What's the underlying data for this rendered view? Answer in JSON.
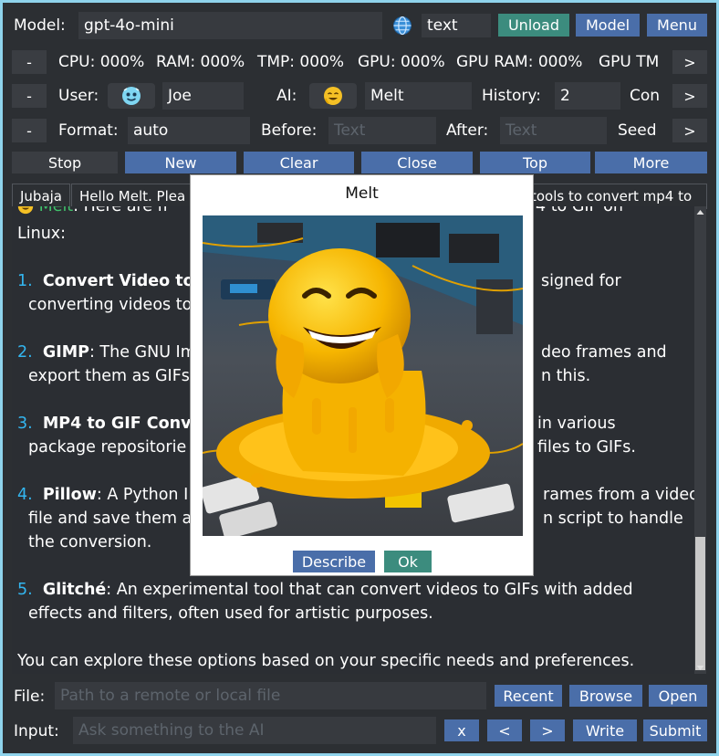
{
  "toolbar": {
    "model_label": "Model:",
    "model_value": "gpt-4o-mini",
    "mode_value": "text",
    "unload_label": "Unload",
    "model_button_label": "Model",
    "menu_label": "Menu"
  },
  "stats": {
    "collapse_label": "-",
    "cpu": "CPU: 000%",
    "ram": "RAM: 000%",
    "tmp": "TMP: 000%",
    "gpu": "GPU: 000%",
    "gpu_ram": "GPU RAM: 000%",
    "gpu_tmp": "GPU TM",
    "next_label": ">"
  },
  "users": {
    "collapse_label": "-",
    "user_label": "User:",
    "user_name": "Joe",
    "ai_label": "AI:",
    "ai_name": "Melt",
    "history_label": "History:",
    "history_value": "2",
    "con_label": "Con",
    "next_label": ">"
  },
  "format": {
    "collapse_label": "-",
    "format_label": "Format:",
    "format_value": "auto",
    "before_label": "Before:",
    "before_placeholder": "Text",
    "after_label": "After:",
    "after_placeholder": "Text",
    "seed_label": "Seed",
    "next_label": ">"
  },
  "actions": {
    "stop": "Stop",
    "new": "New",
    "clear": "Clear",
    "close": "Close",
    "top": "Top",
    "more": "More"
  },
  "tabs": [
    {
      "label": "Jubaja"
    },
    {
      "label": "Hello Melt. Plea"
    },
    {
      "label": "tools to convert mp4 to"
    }
  ],
  "chat": {
    "header_name": "Melt",
    "header_rest": ": Here are fr",
    "header_right": "4 to GIF on",
    "line_linux": "Linux:",
    "items": [
      {
        "num": "1.",
        "title": "Convert Video to",
        "rest": "",
        "right": "signed for",
        "line2": "converting videos to",
        "line2_right": ""
      },
      {
        "num": "2.",
        "title": "GIMP",
        "rest": ": The GNU Im",
        "right": "deo frames and",
        "line2": "export them as GIFs",
        "line2_right": "n this."
      },
      {
        "num": "3.",
        "title": "MP4 to GIF Conve",
        "rest": "",
        "right": "in various",
        "line2": "package repositorie",
        "line2_right": "files to GIFs."
      },
      {
        "num": "4.",
        "title": "Pillow",
        "rest": ": A Python I",
        "right": "rames from a video",
        "line2": "file and save them a",
        "line2_right": "n script to handle",
        "line3": "the conversion."
      },
      {
        "num": "5.",
        "title": "Glitché",
        "rest": ": An experimental tool that can convert videos to GIFs with added",
        "line2": "effects and filters, often used for artistic purposes."
      }
    ],
    "footer": "You can explore these options based on your specific needs and preferences."
  },
  "file_row": {
    "label": "File:",
    "placeholder": "Path to a remote or local file",
    "recent": "Recent",
    "browse": "Browse",
    "open": "Open"
  },
  "input_row": {
    "label": "Input:",
    "placeholder": "Ask something to the AI",
    "x": "x",
    "prev": "<",
    "next": ">",
    "write": "Write",
    "submit": "Submit"
  },
  "modal": {
    "title": "Melt",
    "describe": "Describe",
    "ok": "Ok"
  },
  "colors": {
    "accent_blue": "#4a6ea9",
    "accent_teal": "#3c8c7e",
    "background": "#2c2f33",
    "frame": "#8fd3ec",
    "number_blue": "#33b6f0"
  }
}
